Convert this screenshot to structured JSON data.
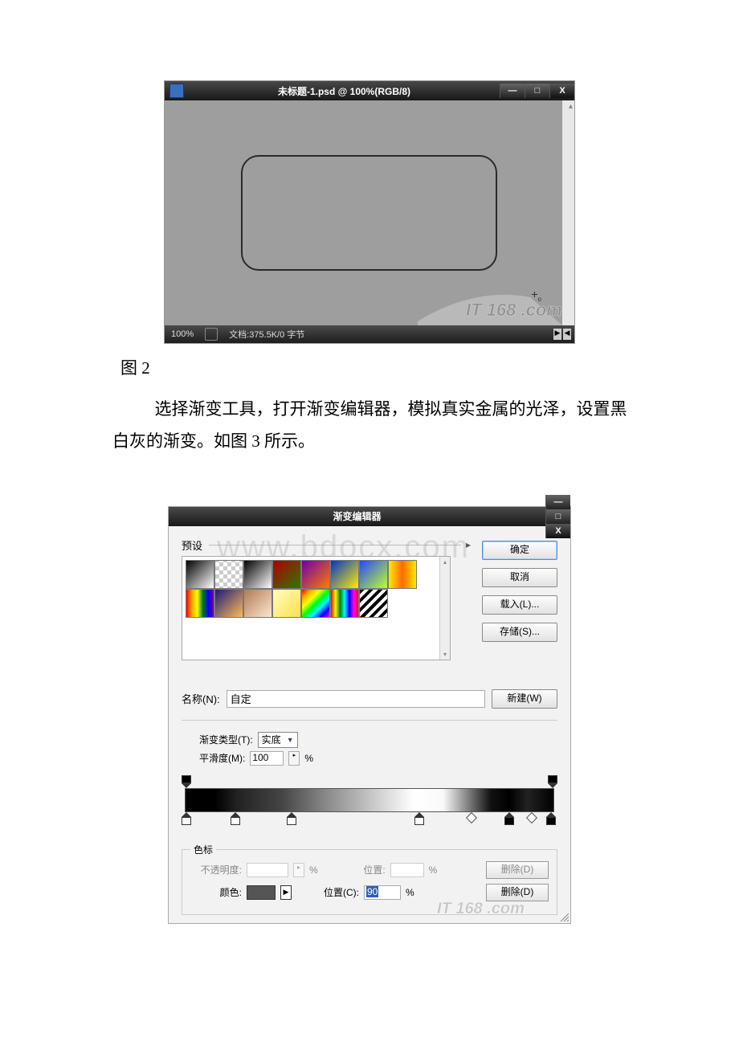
{
  "fig1": {
    "title": "未标题-1.psd @ 100%(RGB/8)",
    "zoom": "100%",
    "doc_info": "文档:375.5K/0 字节"
  },
  "caption1": "图 2",
  "paragraph": "选择渐变工具，打开渐变编辑器，模拟真实金属的光泽，设置黑白灰的渐变。如图 3 所示。",
  "gradEditor": {
    "title": "渐变编辑器",
    "presets_label": "预设",
    "btn_ok": "确定",
    "btn_cancel": "取消",
    "btn_load": "载入(L)...",
    "btn_save": "存储(S)...",
    "name_label": "名称(N):",
    "name_value": "自定",
    "btn_new": "新建(W)",
    "type_label": "渐变类型(T):",
    "type_value": "实底",
    "smooth_label": "平滑度(M):",
    "smooth_value": "100",
    "percent": "%",
    "stops_legend": "色标",
    "opacity_label": "不透明度:",
    "position_label": "位置:",
    "color_label": "颜色:",
    "position2_label": "位置(C):",
    "position2_value": "90",
    "delete_label": "删除(D)",
    "watermark2": "IT 168 .com"
  },
  "watermark_bdocx": "www.bdocx.com",
  "watermark_it168": "IT 168 .com",
  "icons": {
    "minimize": "—",
    "maximize": "□",
    "close": "X",
    "flyout": "▸",
    "dropdown": "▼",
    "scroll_up": "▴",
    "scroll_down": "▾",
    "slider_left": "▶",
    "slider_right": "◀",
    "colorarrow": "▶"
  }
}
